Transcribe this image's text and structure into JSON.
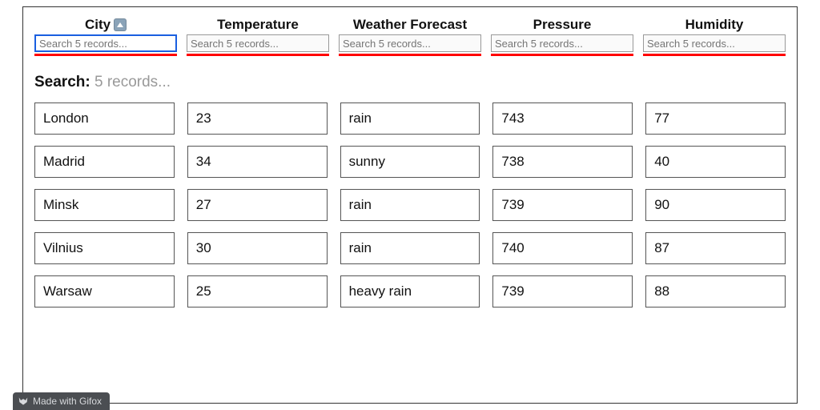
{
  "columns": [
    {
      "title": "City",
      "placeholder": "Search 5 records...",
      "sortable": true
    },
    {
      "title": "Temperature",
      "placeholder": "Search 5 records..."
    },
    {
      "title": "Weather Forecast",
      "placeholder": "Search 5 records..."
    },
    {
      "title": "Pressure",
      "placeholder": "Search 5 records..."
    },
    {
      "title": "Humidity",
      "placeholder": "Search 5 records..."
    }
  ],
  "search": {
    "label": "Search:",
    "hint": "5 records..."
  },
  "rows": [
    {
      "city": "London",
      "temperature": "23",
      "forecast": "rain",
      "pressure": "743",
      "humidity": "77"
    },
    {
      "city": "Madrid",
      "temperature": "34",
      "forecast": "sunny",
      "pressure": "738",
      "humidity": "40"
    },
    {
      "city": "Minsk",
      "temperature": "27",
      "forecast": "rain",
      "pressure": "739",
      "humidity": "90"
    },
    {
      "city": "Vilnius",
      "temperature": "30",
      "forecast": "rain",
      "pressure": "740",
      "humidity": "87"
    },
    {
      "city": "Warsaw",
      "temperature": "25",
      "forecast": "heavy rain",
      "pressure": "739",
      "humidity": "88"
    }
  ],
  "badge": {
    "text": "Made with Gifox"
  }
}
